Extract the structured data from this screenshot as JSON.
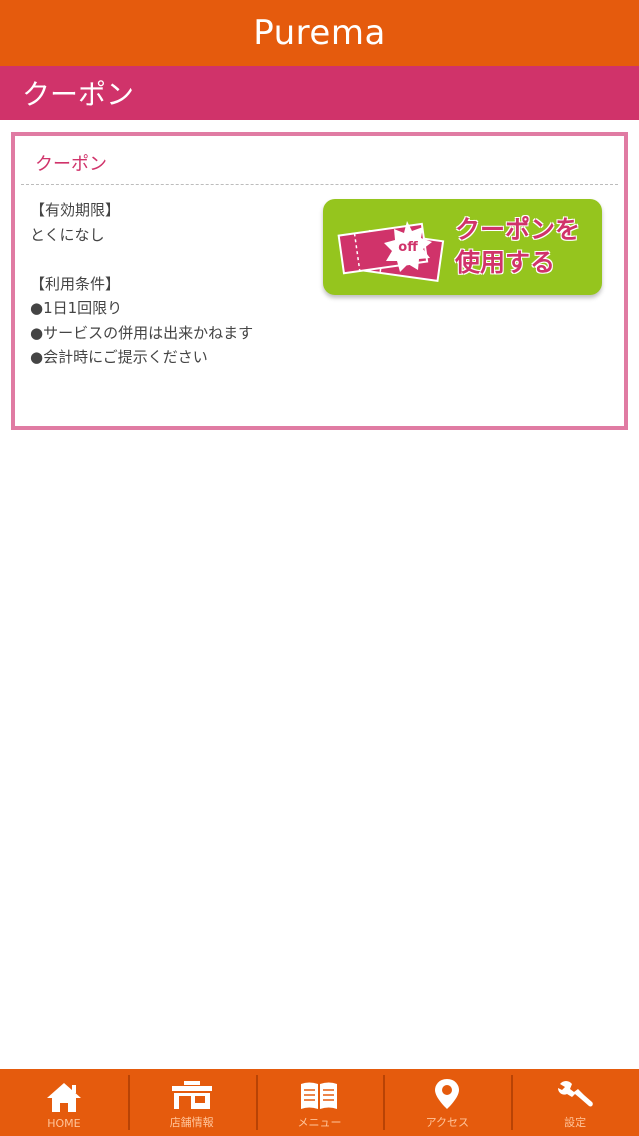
{
  "header": {
    "title": "Purema"
  },
  "section": {
    "title": "クーポン"
  },
  "coupon": {
    "title": "クーポン",
    "expiry_label": "【有効期限】",
    "expiry_value": "とくになし",
    "terms_label": "【利用条件】",
    "terms": [
      "●1日1回限り",
      "●サービスの併用は出来かねます",
      "●会計時にご提示ください"
    ],
    "button": {
      "label": "クーポンを\n使用する",
      "badge": "off"
    }
  },
  "tabs": [
    {
      "label": "HOME",
      "icon": "home-icon"
    },
    {
      "label": "店舗情報",
      "icon": "shop-icon"
    },
    {
      "label": "メニュー",
      "icon": "menu-book-icon"
    },
    {
      "label": "アクセス",
      "icon": "map-pin-icon"
    },
    {
      "label": "設定",
      "icon": "wrench-icon"
    }
  ],
  "colors": {
    "header_bg": "#e55b0d",
    "section_bg": "#d0336a",
    "card_border": "#e07ba3",
    "button_bg": "#95c51e"
  }
}
